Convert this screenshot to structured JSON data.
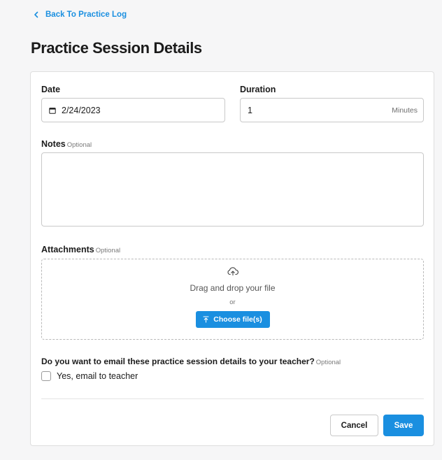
{
  "nav": {
    "back_label": "Back To Practice Log",
    "back_icon": "chevron-left-icon"
  },
  "page": {
    "title": "Practice Session Details"
  },
  "form": {
    "date": {
      "label": "Date",
      "value": "2/24/2023",
      "icon": "calendar-icon"
    },
    "duration": {
      "label": "Duration",
      "value": "1",
      "unit": "Minutes"
    },
    "notes": {
      "label": "Notes",
      "optional": "Optional",
      "value": ""
    },
    "attachments": {
      "label": "Attachments",
      "optional": "Optional",
      "drop_text": "Drag and drop your file",
      "or_text": "or",
      "choose_label": "Choose file(s)",
      "upload_icon": "cloud-upload-icon"
    },
    "email": {
      "question": "Do you want to email these practice session details to your teacher?",
      "optional": "Optional",
      "checkbox_label": "Yes, email to teacher",
      "checked": false
    }
  },
  "actions": {
    "cancel_label": "Cancel",
    "save_label": "Save"
  },
  "colors": {
    "accent": "#1a8fe0",
    "background": "#f6f6f7",
    "card": "#ffffff"
  }
}
